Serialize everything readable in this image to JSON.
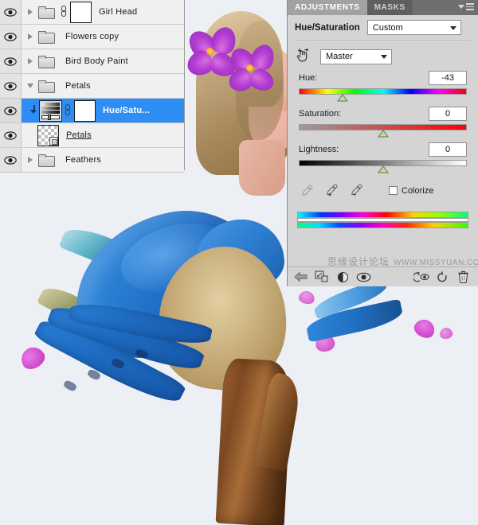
{
  "app": {
    "name": "Adobe Photoshop",
    "accent_selected": "#2f8ef4",
    "panel_bg": "#d4d4d4",
    "canvas_bg": "#eceff4"
  },
  "layers_panel": {
    "name": "Layers",
    "rows": [
      {
        "label": "Girl Head",
        "type": "group",
        "expanded": false,
        "visible": true,
        "selected": false,
        "has_folder": true,
        "has_chain": true,
        "has_mask": true,
        "mask_kind": "white",
        "clipped": false,
        "underline": false,
        "bold": false,
        "eye_icon": "eye-icon",
        "triangle_icon": "triangle-right-icon",
        "folder_icon": "folder-icon",
        "chain_icon": "link-icon",
        "mask_icon": "layer-mask-thumbnail"
      },
      {
        "label": "Flowers copy",
        "type": "group",
        "expanded": false,
        "visible": true,
        "selected": false,
        "has_folder": true,
        "has_chain": false,
        "has_mask": false,
        "mask_kind": "",
        "clipped": false,
        "underline": false,
        "bold": false,
        "eye_icon": "eye-icon",
        "triangle_icon": "triangle-right-icon",
        "folder_icon": "folder-icon"
      },
      {
        "label": "Bird Body Paint",
        "type": "group",
        "expanded": false,
        "visible": true,
        "selected": false,
        "has_folder": true,
        "has_chain": false,
        "has_mask": false,
        "mask_kind": "",
        "clipped": false,
        "underline": false,
        "bold": false,
        "eye_icon": "eye-icon",
        "triangle_icon": "triangle-right-icon",
        "folder_icon": "folder-icon"
      },
      {
        "label": "Petals",
        "type": "group",
        "expanded": true,
        "visible": true,
        "selected": false,
        "has_folder": true,
        "has_chain": false,
        "has_mask": false,
        "mask_kind": "",
        "clipped": false,
        "underline": false,
        "bold": false,
        "eye_icon": "eye-icon",
        "triangle_icon": "triangle-down-icon",
        "folder_icon": "folder-icon"
      },
      {
        "label": "Hue/Satu...",
        "type": "adjustment",
        "expanded": false,
        "visible": true,
        "selected": true,
        "has_folder": false,
        "has_chain": true,
        "has_mask": true,
        "mask_kind": "white",
        "clipped": true,
        "underline": false,
        "bold": true,
        "eye_icon": "eye-icon",
        "clip_icon": "clipping-mask-arrow-icon",
        "thumb_icon": "hue-saturation-adjustment-thumbnail",
        "chain_icon": "link-icon",
        "mask_icon": "layer-mask-thumbnail"
      },
      {
        "label": "Petals",
        "type": "smart-object",
        "expanded": false,
        "visible": true,
        "selected": false,
        "has_folder": false,
        "has_chain": false,
        "has_mask": false,
        "mask_kind": "checker",
        "clipped": false,
        "underline": true,
        "bold": false,
        "eye_icon": "eye-icon",
        "thumb_icon": "transparent-layer-thumbnail",
        "badge_icon": "smart-object-badge-icon"
      },
      {
        "label": "Feathers",
        "type": "group",
        "expanded": false,
        "visible": true,
        "selected": false,
        "has_folder": true,
        "has_chain": false,
        "has_mask": false,
        "mask_kind": "",
        "clipped": false,
        "underline": false,
        "bold": false,
        "eye_icon": "eye-icon",
        "triangle_icon": "triangle-right-icon",
        "folder_icon": "folder-icon"
      }
    ]
  },
  "adjustments_panel": {
    "tabs": [
      {
        "label": "ADJUSTMENTS",
        "active": true
      },
      {
        "label": "MASKS",
        "active": false
      }
    ],
    "menu_icon": "panel-menu-icon",
    "title": "Hue/Saturation",
    "preset": {
      "value": "Custom",
      "caret_icon": "chevron-down-icon"
    },
    "on_image_tool_icon": "on-image-adjustment-icon",
    "channel": {
      "value": "Master",
      "caret_icon": "chevron-down-icon"
    },
    "sliders": [
      {
        "label": "Hue:",
        "value": "-43",
        "percent": 26.0,
        "track": "hue"
      },
      {
        "label": "Saturation:",
        "value": "0",
        "percent": 50.0,
        "track": "sat"
      },
      {
        "label": "Lightness:",
        "value": "0",
        "percent": 50.0,
        "track": "light"
      }
    ],
    "eyedroppers": [
      {
        "name": "eyedropper-icon",
        "state": "disabled"
      },
      {
        "name": "eyedropper-add-icon",
        "state": "enabled"
      },
      {
        "name": "eyedropper-subtract-icon",
        "state": "enabled"
      }
    ],
    "colorize": {
      "label": "Colorize",
      "checked": false
    },
    "hue_ramps": {
      "top_label": "input-hue-ramp",
      "bottom_label": "output-hue-ramp"
    },
    "watermark": {
      "cn": "思缘设计论坛",
      "en": "WWW.MISSYUAN.COM"
    },
    "footer_buttons": [
      {
        "name": "return-to-adjustment-list-icon",
        "label": "back"
      },
      {
        "name": "clip-to-layer-icon",
        "label": "clip"
      },
      {
        "name": "toggle-layer-visibility-circle-icon",
        "label": "toggle"
      },
      {
        "name": "preview-eye-icon",
        "label": "preview"
      },
      {
        "name": "view-previous-state-icon",
        "label": "previous"
      },
      {
        "name": "reset-adjustment-icon",
        "label": "reset"
      },
      {
        "name": "delete-adjustment-icon",
        "label": "delete"
      }
    ]
  },
  "artwork": {
    "description": "Digital painting of a blue bird with a girl's head, purple flowers, scattered feathers and petals, perched on a wooden branch",
    "subject_icons": [
      "bird-illustration",
      "girl-head-illustration",
      "flower-illustration",
      "feather-illustration",
      "branch-illustration"
    ]
  }
}
